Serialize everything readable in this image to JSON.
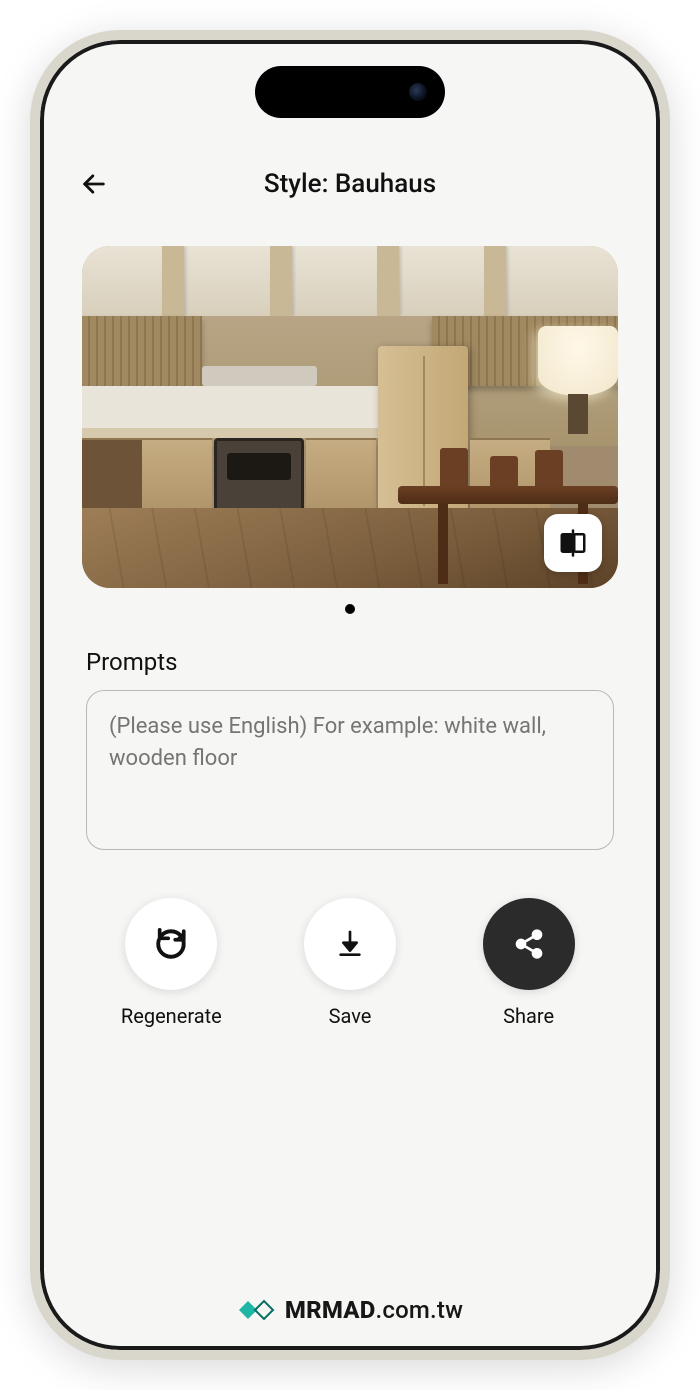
{
  "header": {
    "title": "Style: Bauhaus"
  },
  "prompts": {
    "section_label": "Prompts",
    "placeholder": "(Please use English) For example: white wall, wooden floor"
  },
  "actions": {
    "regenerate": "Regenerate",
    "save": "Save",
    "share": "Share"
  },
  "watermark": {
    "brand": "MRMAD",
    "domain": ".com.tw"
  },
  "icons": {
    "back": "back-arrow-icon",
    "compare": "compare-split-icon",
    "regenerate": "refresh-icon",
    "save": "download-icon",
    "share": "share-icon"
  },
  "colors": {
    "accent_dark": "#2b2b2b",
    "teal": "#1fb6a6"
  }
}
